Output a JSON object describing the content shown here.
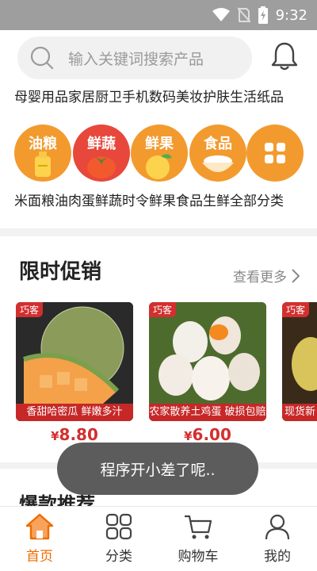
{
  "status": {
    "time": "9:32"
  },
  "search": {
    "placeholder": "输入关键词搜索产品"
  },
  "top_categories": [
    "母婴用品",
    "家居厨卫",
    "手机数码",
    "美妆护肤",
    "生活纸品"
  ],
  "circle_categories": [
    {
      "badge": "油粮",
      "label": "米面粮油",
      "icon": "oil-bottle-icon"
    },
    {
      "badge": "鲜蔬",
      "label": "肉蛋鲜蔬",
      "icon": "tomato-icon"
    },
    {
      "badge": "鲜果",
      "label": "时令鲜果",
      "icon": "orange-fruit-icon"
    },
    {
      "badge": "食品",
      "label": "食品生鲜",
      "icon": "rice-bowl-icon"
    },
    {
      "badge": "",
      "label": "全部分类",
      "icon": "grid-icon"
    }
  ],
  "promo": {
    "title": "限时促销",
    "see_more": "查看更多",
    "products": [
      {
        "tag": "巧客",
        "banner": "香甜哈密瓜 鲜嫩多汁",
        "currency": "¥",
        "price": "8.80",
        "image": "hami-melon"
      },
      {
        "tag": "巧客",
        "banner": "农家散养土鸡蛋 破损包赔",
        "currency": "¥",
        "price": "6.00",
        "image": "eggs"
      },
      {
        "tag": "巧客",
        "banner": "现货新",
        "currency": "",
        "price": "",
        "image": "pear"
      }
    ]
  },
  "hot": {
    "title": "爆款推荐"
  },
  "toast": {
    "message": "程序开小差了呢.."
  },
  "tabbar": {
    "tabs": [
      {
        "label": "首页",
        "icon": "home-icon",
        "active": true
      },
      {
        "label": "分类",
        "icon": "category-grid-icon",
        "active": false
      },
      {
        "label": "购物车",
        "icon": "cart-icon",
        "active": false
      },
      {
        "label": "我的",
        "icon": "user-icon",
        "active": false
      }
    ]
  },
  "colors": {
    "accent": "#ef6c00",
    "price": "#d32f2f",
    "circle_orange": "#f39a2e",
    "circle_red": "#e8473b"
  }
}
